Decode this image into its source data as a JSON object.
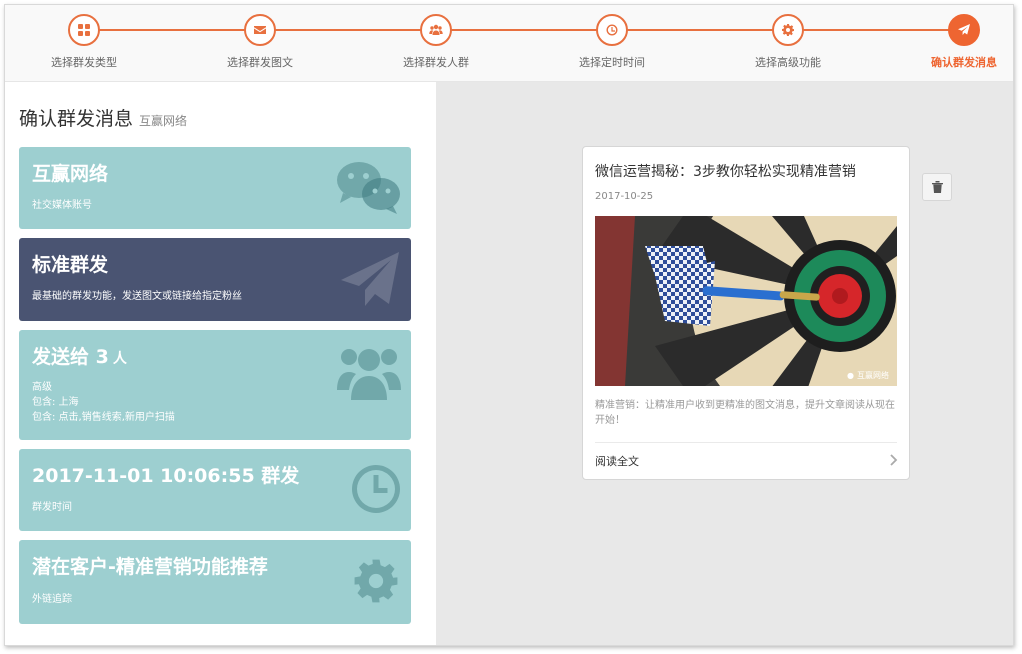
{
  "steps": [
    {
      "label": "选择群发类型",
      "icon": "grid-icon"
    },
    {
      "label": "选择群发图文",
      "icon": "envelope-icon"
    },
    {
      "label": "选择群发人群",
      "icon": "users-icon"
    },
    {
      "label": "选择定时时间",
      "icon": "clock-icon"
    },
    {
      "label": "选择高级功能",
      "icon": "gear-icon"
    },
    {
      "label": "确认群发消息",
      "icon": "paper-plane-icon",
      "active": true
    }
  ],
  "page": {
    "title": "确认群发消息",
    "subtitle": "互赢网络"
  },
  "cards": {
    "account": {
      "title": "互赢网络",
      "text": "社交媒体账号",
      "icon": "wechat-icon"
    },
    "type": {
      "title": "标准群发",
      "text": "最基础的群发功能，发送图文或链接给指定粉丝",
      "icon": "paper-plane-icon"
    },
    "audience": {
      "title_prefix": "发送给 3",
      "unit": "人",
      "lines": [
        "高级",
        "包含: 上海",
        "包含: 点击,销售线索,新用户扫描"
      ],
      "icon": "users-icon"
    },
    "schedule": {
      "title": "2017-11-01 10:06:55 群发",
      "text": "群发时间",
      "icon": "clock-icon"
    },
    "advanced": {
      "title": "潜在客户-精准营销功能推荐",
      "text": "外链追踪",
      "icon": "gear-icon"
    }
  },
  "article": {
    "title": "微信运营揭秘：3步教你轻松实现精准营销",
    "date": "2017-10-25",
    "image_watermark": "互赢网络",
    "description": "精准营销：让精准用户收到更精准的图文消息，提升文章阅读从现在开始！",
    "read_more": "阅读全文"
  },
  "actions": {
    "delete_icon": "trash-icon"
  },
  "colors": {
    "accent": "#ee6531",
    "card_teal": "#9dcfd0",
    "card_dark": "#4a5472",
    "preview_bg": "#e8e8e8"
  }
}
